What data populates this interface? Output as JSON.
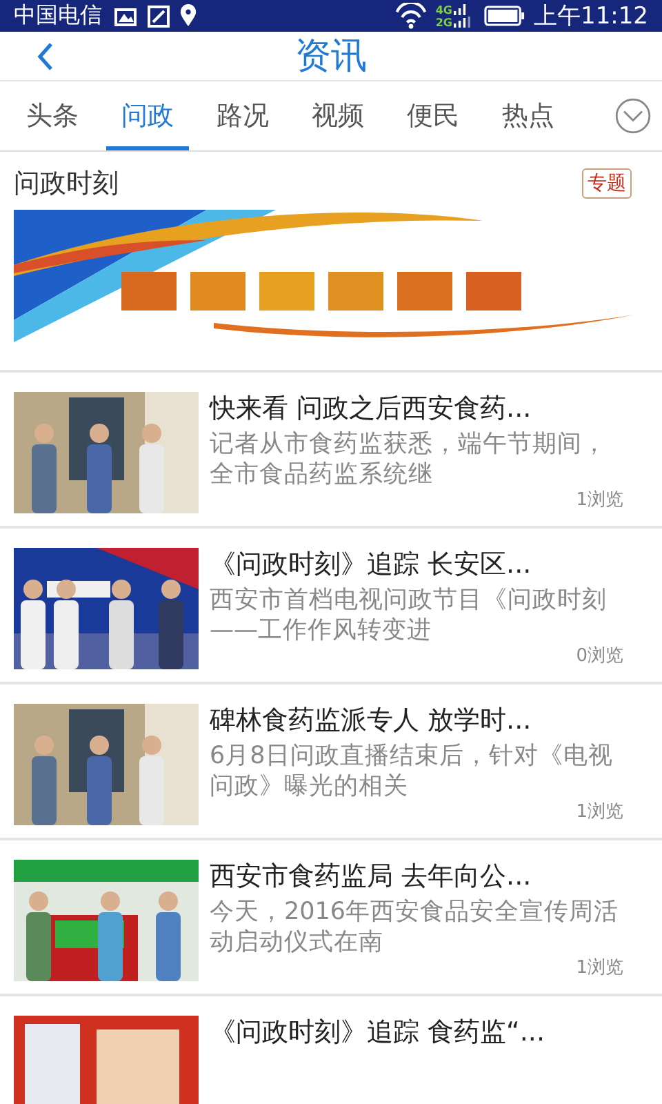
{
  "status_bar": {
    "carrier": "中国电信",
    "network_top": "4G",
    "network_bottom": "2G",
    "time": "上午11:12"
  },
  "header": {
    "title": "资讯"
  },
  "tabs": [
    {
      "label": "头条",
      "selected": false
    },
    {
      "label": "问政",
      "selected": true
    },
    {
      "label": "路况",
      "selected": false
    },
    {
      "label": "视频",
      "selected": false
    },
    {
      "label": "便民",
      "selected": false
    },
    {
      "label": "热点",
      "selected": false
    }
  ],
  "section": {
    "title": "问政时刻",
    "badge": "专题"
  },
  "articles": [
    {
      "title": "快来看 问政之后西安食药...",
      "summary": "记者从市食药监获悉，端午节期间，全市食品药监系统继",
      "views": "1浏览"
    },
    {
      "title": "《问政时刻》追踪 长安区...",
      "summary": "西安市首档电视问政节目《问政时刻——工作作风转变进",
      "views": "0浏览"
    },
    {
      "title": "碑林食药监派专人 放学时...",
      "summary": "6月8日问政直播结束后，针对《电视问政》曝光的相关",
      "views": "1浏览"
    },
    {
      "title": "西安市食药监局 去年向公...",
      "summary": "今天，2016年西安食品安全宣传周活动启动仪式在南",
      "views": "1浏览"
    },
    {
      "title": "《问政时刻》追踪 食药监“..."
    }
  ]
}
